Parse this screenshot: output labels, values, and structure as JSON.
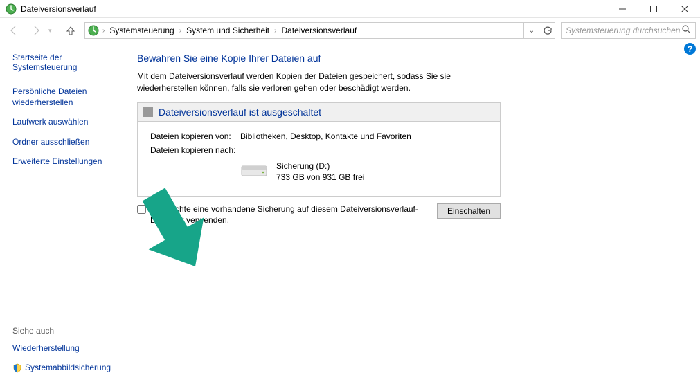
{
  "titlebar": {
    "title": "Dateiversionsverlauf"
  },
  "navbar": {
    "breadcrumb": [
      "Systemsteuerung",
      "System und Sicherheit",
      "Dateiversionsverlauf"
    ],
    "search_placeholder": "Systemsteuerung durchsuchen"
  },
  "sidebar": {
    "start": "Startseite der Systemsteuerung",
    "links": [
      "Persönliche Dateien wiederherstellen",
      "Laufwerk auswählen",
      "Ordner ausschließen",
      "Erweiterte Einstellungen"
    ],
    "see_also_header": "Siehe auch",
    "see_also": [
      "Wiederherstellung",
      "Systemabbildsicherung"
    ]
  },
  "main": {
    "heading": "Bewahren Sie eine Kopie Ihrer Dateien auf",
    "description": "Mit dem Dateiversionsverlauf werden Kopien der Dateien gespeichert, sodass Sie sie wiederherstellen können, falls sie verloren gehen oder beschädigt werden.",
    "status_title": "Dateiversionsverlauf ist ausgeschaltet",
    "copy_from_label": "Dateien kopieren von:",
    "copy_from_value": "Bibliotheken, Desktop, Kontakte und Favoriten",
    "copy_to_label": "Dateien kopieren nach:",
    "drive_name": "Sicherung (D:)",
    "drive_space": "733 GB von 931 GB frei",
    "checkbox_label": "Ich möchte eine vorhandene Sicherung auf diesem Dateiversionsverlauf-Laufwerk verwenden.",
    "enable_button": "Einschalten",
    "help": "?"
  },
  "colors": {
    "link": "#003399",
    "accent": "#0078d7",
    "arrow": "#17a589"
  }
}
